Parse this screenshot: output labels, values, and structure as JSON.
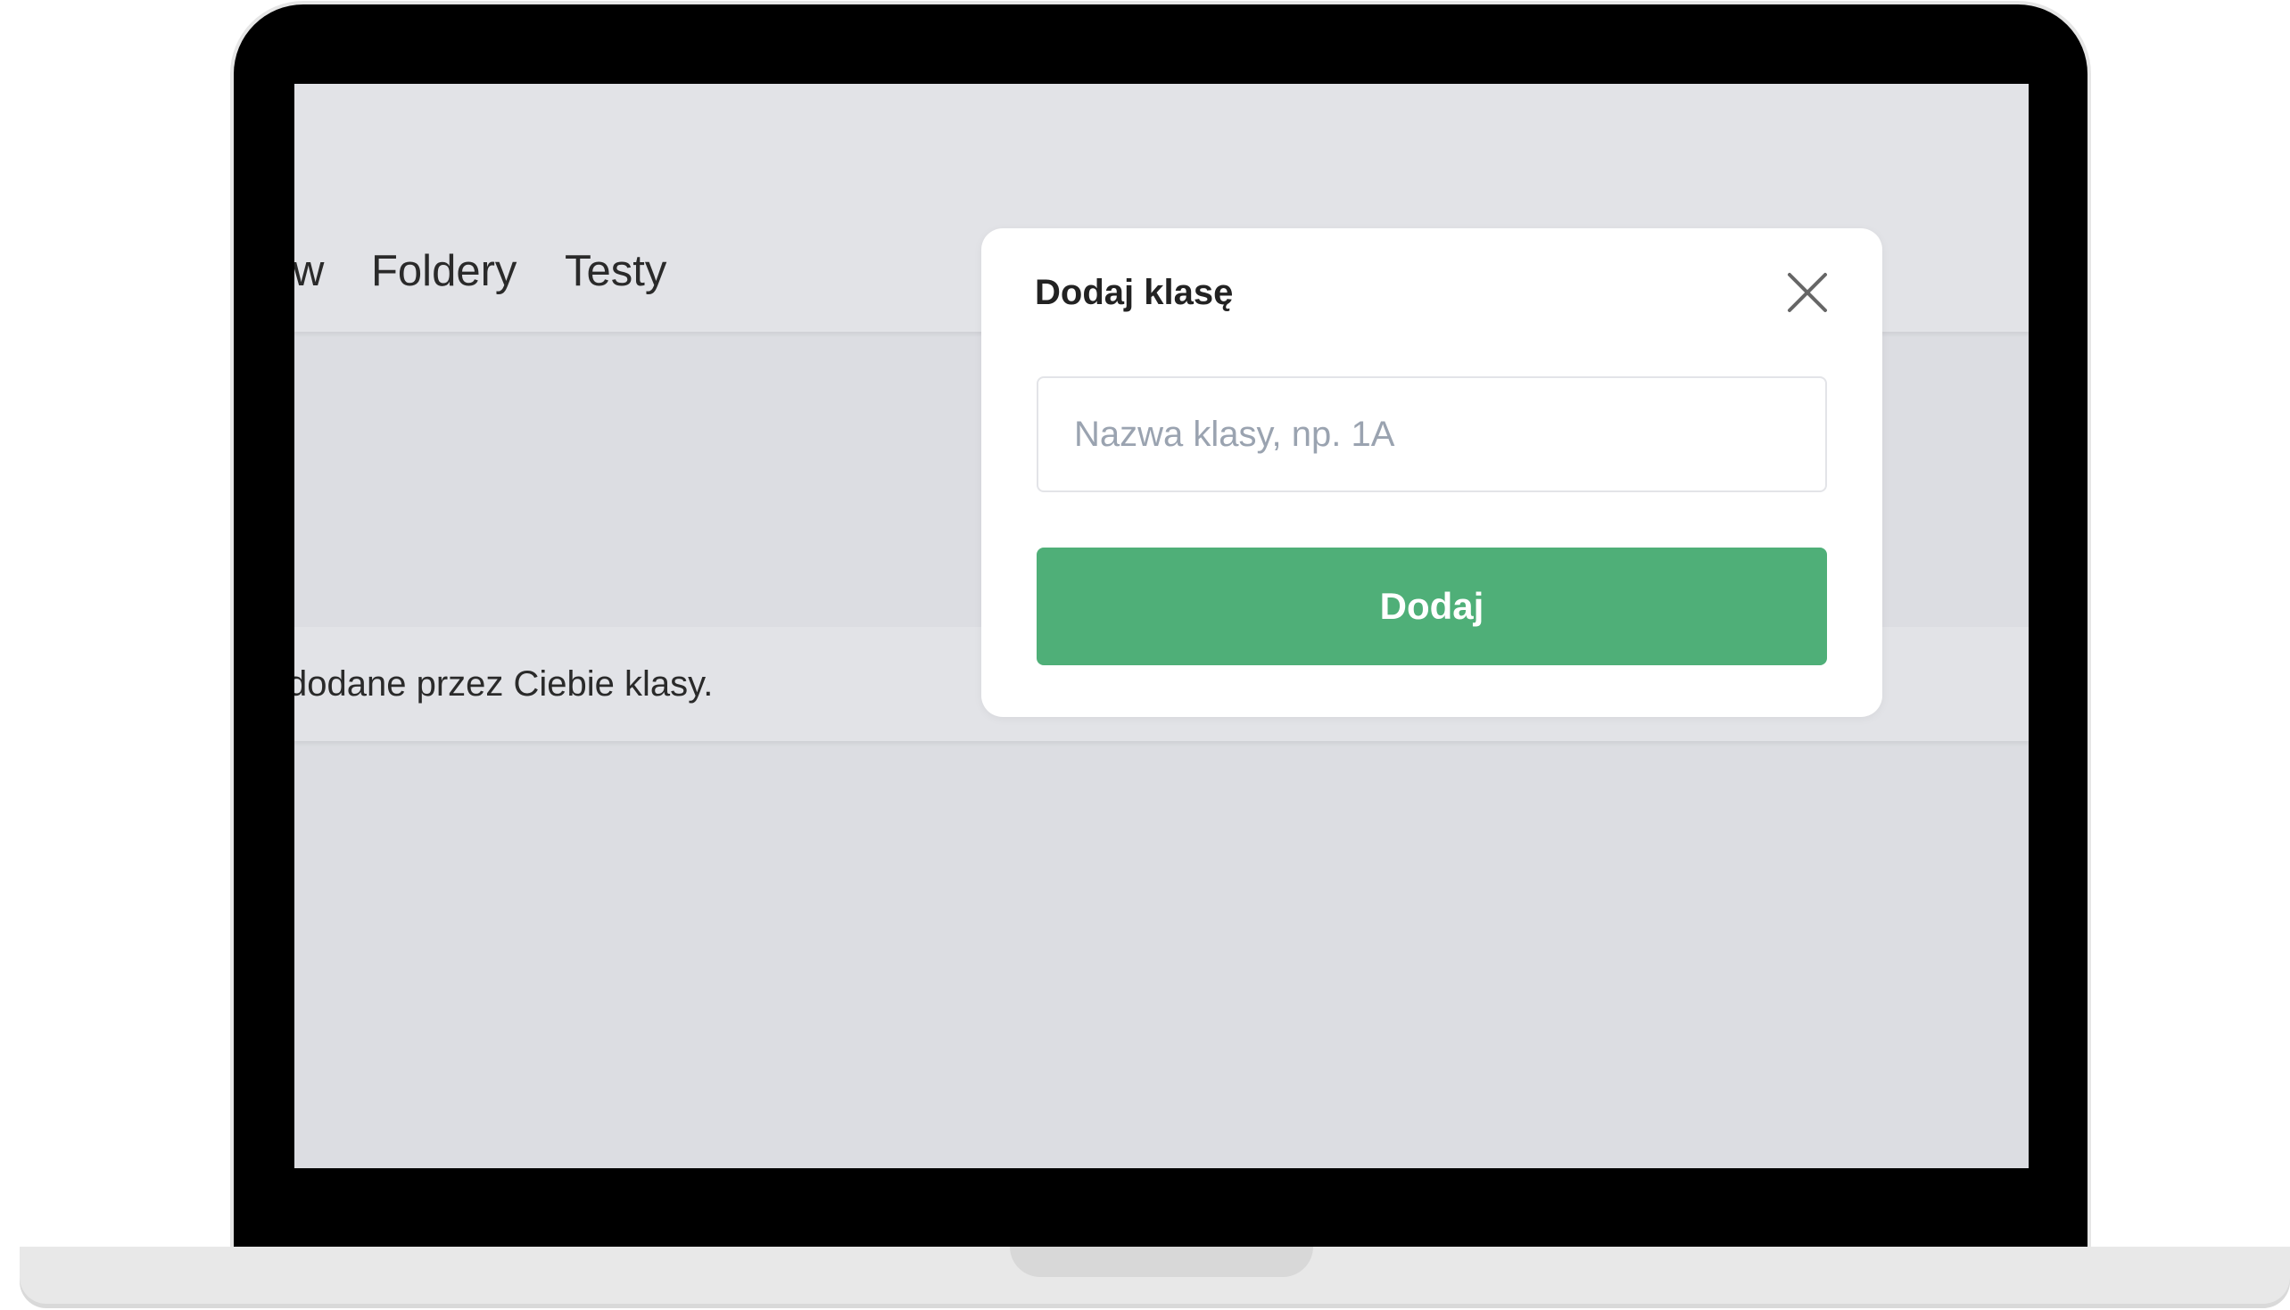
{
  "nav": {
    "partial_item": "w",
    "folders": "Foldery",
    "tests": "Testy"
  },
  "info": {
    "text": "dodane przez Ciebie klasy."
  },
  "modal": {
    "title": "Dodaj klasę",
    "input_placeholder": "Nazwa klasy, np. 1A",
    "input_value": "",
    "submit_label": "Dodaj",
    "close_icon": "close-icon"
  },
  "colors": {
    "primary_button": "#4faf78",
    "screen_background": "#dcdde2",
    "bezel": "#000000"
  }
}
